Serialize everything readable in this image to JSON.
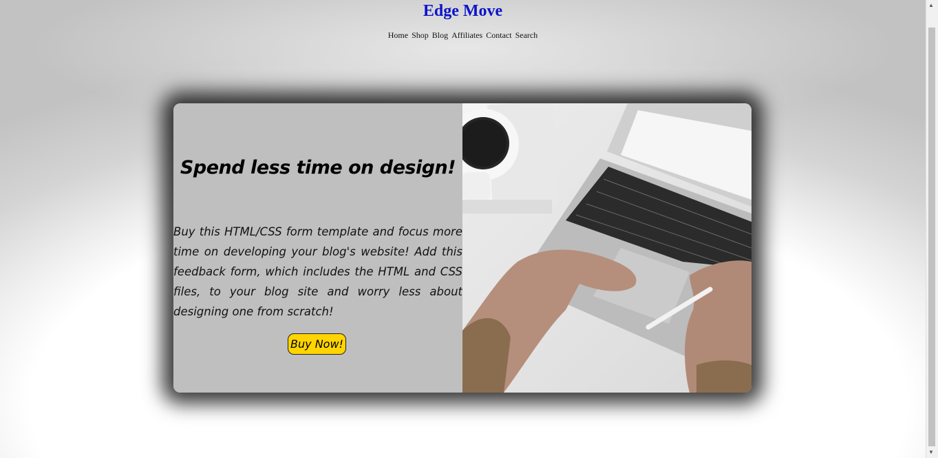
{
  "site": {
    "title": "Edge Move"
  },
  "nav": {
    "items": [
      "Home",
      "Shop",
      "Blog",
      "Affiliates",
      "Contact",
      "Search"
    ]
  },
  "hero": {
    "headline": "Spend less time on design!",
    "body": "Buy this HTML/CSS form template and focus more time on developing your blog's website! Add this feedback form, which includes the HTML and CSS files, to your blog site and worry less about designing one from scratch!",
    "button_label": "Buy Now!",
    "image_icon": "laptop-workspace-photo"
  },
  "colors": {
    "title": "#0b14c8",
    "button": "#ffd400",
    "panel": "#bfbfbf"
  }
}
